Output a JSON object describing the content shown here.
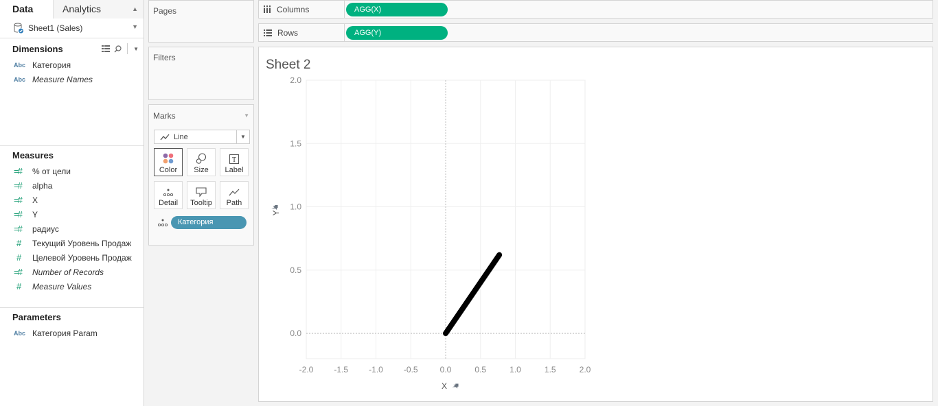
{
  "left_pane": {
    "tabs": {
      "data": "Data",
      "analytics": "Analytics"
    },
    "datasource": "Sheet1 (Sales)",
    "dimensions": {
      "title": "Dimensions",
      "items": [
        {
          "type": "Abc",
          "label": "Категория",
          "italic": false
        },
        {
          "type": "Abc",
          "label": "Measure Names",
          "italic": true
        }
      ]
    },
    "measures": {
      "title": "Measures",
      "items": [
        {
          "type": "=#",
          "label": "% от цели",
          "italic": false
        },
        {
          "type": "=#",
          "label": "alpha",
          "italic": false
        },
        {
          "type": "=#",
          "label": "X",
          "italic": false
        },
        {
          "type": "=#",
          "label": "Y",
          "italic": false
        },
        {
          "type": "=#",
          "label": "радиус",
          "italic": false
        },
        {
          "type": "#",
          "label": "Текущий Уровень Продаж",
          "italic": false
        },
        {
          "type": "#",
          "label": "Целевой Уровень Продаж",
          "italic": false
        },
        {
          "type": "=#",
          "label": "Number of Records",
          "italic": true
        },
        {
          "type": "#",
          "label": "Measure Values",
          "italic": true
        }
      ]
    },
    "parameters": {
      "title": "Parameters",
      "items": [
        {
          "type": "Abc",
          "label": "Категория Param",
          "italic": false
        }
      ]
    }
  },
  "cards": {
    "pages": "Pages",
    "filters": "Filters",
    "marks": {
      "title": "Marks",
      "mark_type": "Line",
      "buttons": {
        "color": "Color",
        "size": "Size",
        "label": "Label",
        "detail": "Detail",
        "tooltip": "Tooltip",
        "path": "Path"
      },
      "detail_pill": "Категория",
      "color_dots": [
        "#8e6aa8",
        "#ef6f7a",
        "#f2a06e",
        "#6f9bd1"
      ]
    }
  },
  "shelves": {
    "columns": {
      "label": "Columns",
      "pill": "AGG(X)"
    },
    "rows": {
      "label": "Rows",
      "pill": "AGG(Y)"
    }
  },
  "sheet": {
    "title": "Sheet 2"
  },
  "colors": {
    "green_pill": "#00b180",
    "blue_pill": "#4996b2",
    "line": "#000000"
  },
  "chart_data": {
    "type": "line",
    "title": "Sheet 2",
    "xlabel": "X",
    "ylabel": "Y",
    "xlim": [
      -2.0,
      2.0
    ],
    "ylim": [
      -0.2,
      2.0
    ],
    "x_ticks": [
      "-2.0",
      "-1.5",
      "-1.0",
      "-0.5",
      "0.0",
      "0.5",
      "1.0",
      "1.5",
      "2.0"
    ],
    "y_ticks": [
      "0.0",
      "0.5",
      "1.0",
      "1.5",
      "2.0"
    ],
    "grid": true,
    "series": [
      {
        "name": "Категория",
        "x": [
          0.0,
          0.77
        ],
        "y": [
          0.0,
          0.62
        ]
      }
    ]
  }
}
